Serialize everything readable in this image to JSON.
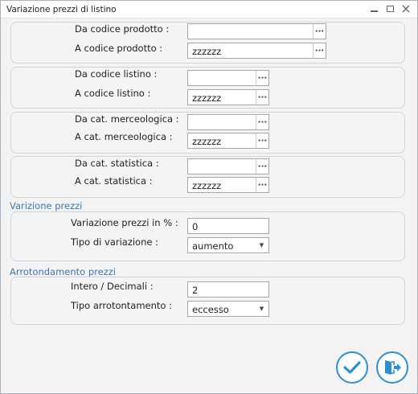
{
  "window": {
    "title": "Variazione prezzi di listino"
  },
  "groups": {
    "prodotto": {
      "from_label": "Da codice prodotto :",
      "from_value": "",
      "to_label": "A codice prodotto :",
      "to_value": "zzzzzz"
    },
    "listino": {
      "from_label": "Da codice listino :",
      "from_value": "",
      "to_label": "A codice listino :",
      "to_value": "zzzzzz"
    },
    "merceologica": {
      "from_label": "Da cat. merceologica :",
      "from_value": "",
      "to_label": "A cat. merceologica :",
      "to_value": "zzzzzz"
    },
    "statistica": {
      "from_label": "Da cat. statistica :",
      "from_value": "",
      "to_label": "A cat. statistica :",
      "to_value": "zzzzzz"
    }
  },
  "variazione": {
    "section_title": "Varizione prezzi",
    "percent_label": "Variazione prezzi in %  :",
    "percent_value": "0",
    "type_label": "Tipo di variazione :",
    "type_value": "aumento"
  },
  "arrotondamento": {
    "section_title": "Arrotondamento prezzi",
    "decimals_label": "Intero / Decimali :",
    "decimals_value": "2",
    "type_label": "Tipo arrotontamento :",
    "type_value": "eccesso"
  },
  "ellipsis_glyph": "···",
  "colors": {
    "accent": "#2c8fd6",
    "section_title": "#3b78b8"
  }
}
